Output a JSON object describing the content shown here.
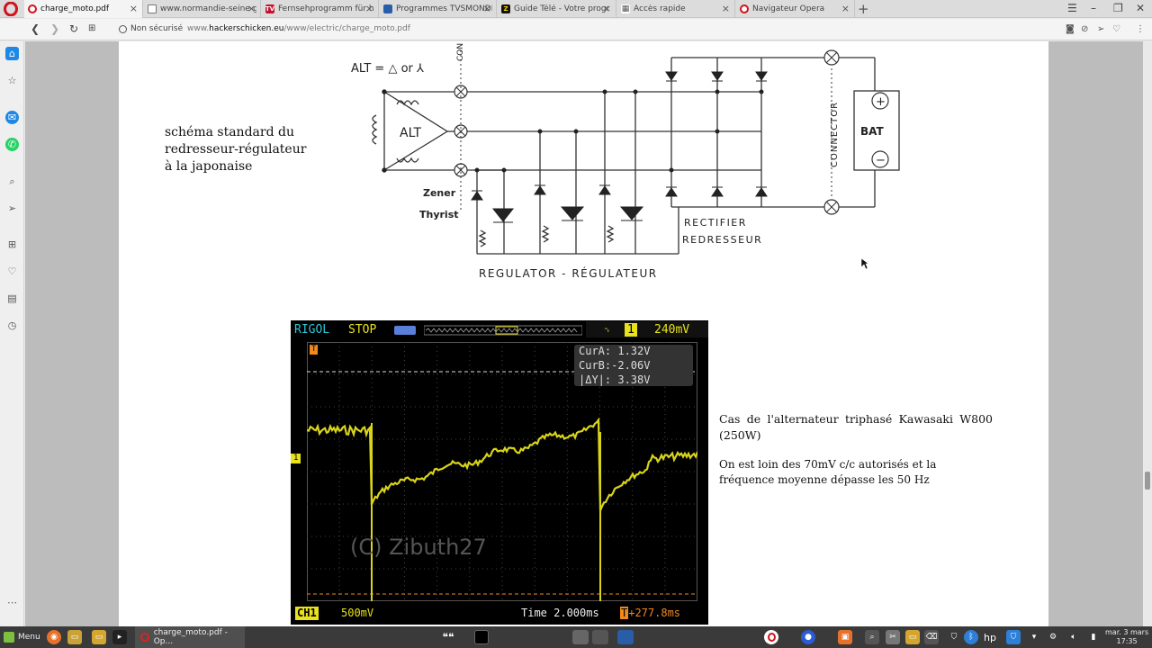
{
  "tabs": [
    {
      "label": "charge_moto.pdf",
      "icon": "opera-icon"
    },
    {
      "label": "www.normandie-seine-g",
      "icon": "page-icon"
    },
    {
      "label": "Fernsehprogramm für h",
      "icon": "tv-icon"
    },
    {
      "label": "Programmes TVSMONDE",
      "icon": "tv5-icon"
    },
    {
      "label": "Guide Télé - Votre progr",
      "icon": "z-icon"
    },
    {
      "label": "Accès rapide",
      "icon": "grid-icon"
    },
    {
      "label": "Navigateur Opera",
      "icon": "opera-icon"
    }
  ],
  "address": {
    "security": "Non sécurisé",
    "url_prefix": "www.",
    "url_host": "hackerschicken.eu",
    "url_path": "/www/electric/charge_moto.pdf"
  },
  "page": {
    "caption_schematic": [
      "schéma standard du",
      "redresseur-régulateur",
      "à la japonaise"
    ],
    "caption_scope_title": "Cas de l'alternateur triphasé Kawasaki W800 (250W)",
    "caption_scope_note": "On est loin des 70mV c/c autorisés et la fréquence moyenne dépasse les 50 Hz"
  },
  "schematic": {
    "alt_formula": "ALT = △ or ⅄",
    "alt_label": "ALT",
    "connector_top": "CON",
    "connector": "CONNECTOR",
    "battery": "BAT",
    "battery_plus": "+",
    "battery_minus": "−",
    "zener": "Zener",
    "thyrist": "Thyrist",
    "rectifier": "RECTIFIER",
    "redresseur": "REDRESSEUR",
    "regulator": "REGULATOR - RÉGULATEUR"
  },
  "scope": {
    "brand": "RIGOL",
    "state": "STOP",
    "trigger_level": "240mV",
    "trigger_channel": "1",
    "cursor_a": "CurA:  1.32V",
    "cursor_b": "CurB:-2.06V",
    "cursor_delta": "|ΔY|: 3.38V",
    "channel": "CH1",
    "volts_div": "500mV",
    "time_div": "Time 2.000ms",
    "trigger_pos": "+277.8ms",
    "watermark": "(C) Zibuth27",
    "marker_ch": "1",
    "marker_t": "T",
    "colors": {
      "trace": "#d9d41a",
      "text_cyan": "#2ec6d8",
      "text_yellow": "#e8e21a",
      "orange": "#f08a1c"
    }
  },
  "taskbar": {
    "menu": "Menu",
    "window": "charge_moto.pdf - Op...",
    "clock_date": "mar. 3 mars",
    "clock_time": "17:35"
  }
}
